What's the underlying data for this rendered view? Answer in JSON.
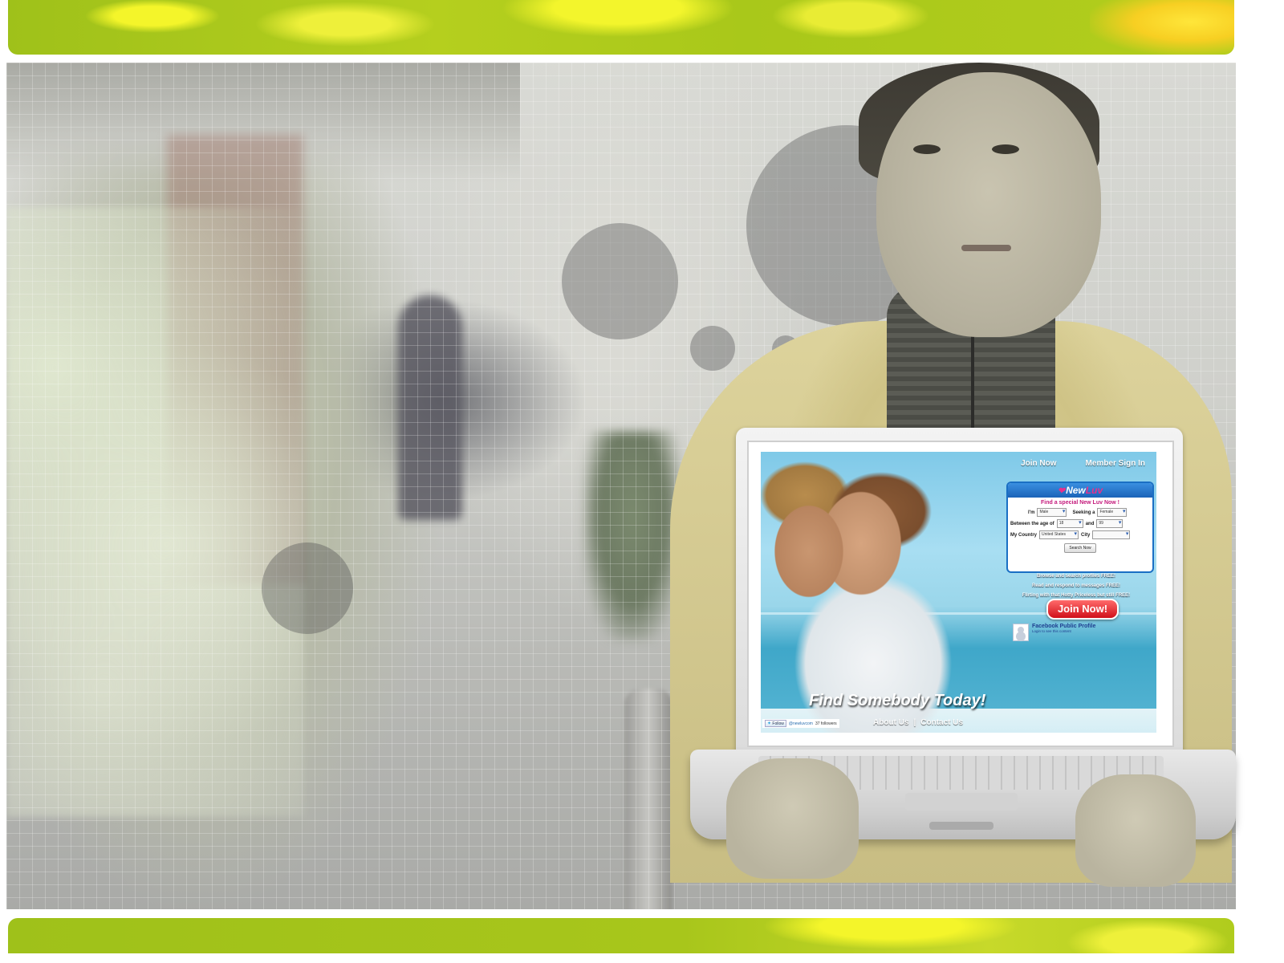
{
  "site": {
    "nav": {
      "join": "Join Now",
      "signin": "Member Sign In"
    },
    "logo": {
      "brand_pre": "New",
      "brand_post": "Luv"
    },
    "search": {
      "title": "Find a special New Luv Now !",
      "im_label": "I'm",
      "im_value": "Male",
      "seeking_label": "Seeking a",
      "seeking_value": "Female",
      "age_label": "Between the age of",
      "age_min": "18",
      "and_label": "and",
      "age_max": "99",
      "country_label": "My Country",
      "country_value": "United States",
      "city_label": "City",
      "city_value": "",
      "button": "Search Now"
    },
    "promo": [
      "Browse and search profiles FREE!",
      "Read and respond to messages FREE!",
      "Flirting with that Hotty Priceless but still FREE!"
    ],
    "join_button": "Join Now!",
    "facebook": {
      "name": "Facebook Public Profile",
      "sub": "Login to see this content"
    },
    "tagline": "Find Somebody Today!",
    "footer": {
      "about": "About Us",
      "separator": "|",
      "contact": "Contact Us"
    },
    "twitter": {
      "follow": "Follow",
      "handle": "@newluvcom",
      "followers": "37 followers"
    }
  },
  "icons": {
    "logo_heart": "heart-icon",
    "twitter_bird": "twitter-bird-icon"
  },
  "colors": {
    "bar_green": "#a9c81a",
    "bar_yellow": "#f4f52a",
    "join_red": "#d0101a",
    "logo_pink": "#e8308c",
    "search_blue": "#1a6fc4"
  }
}
